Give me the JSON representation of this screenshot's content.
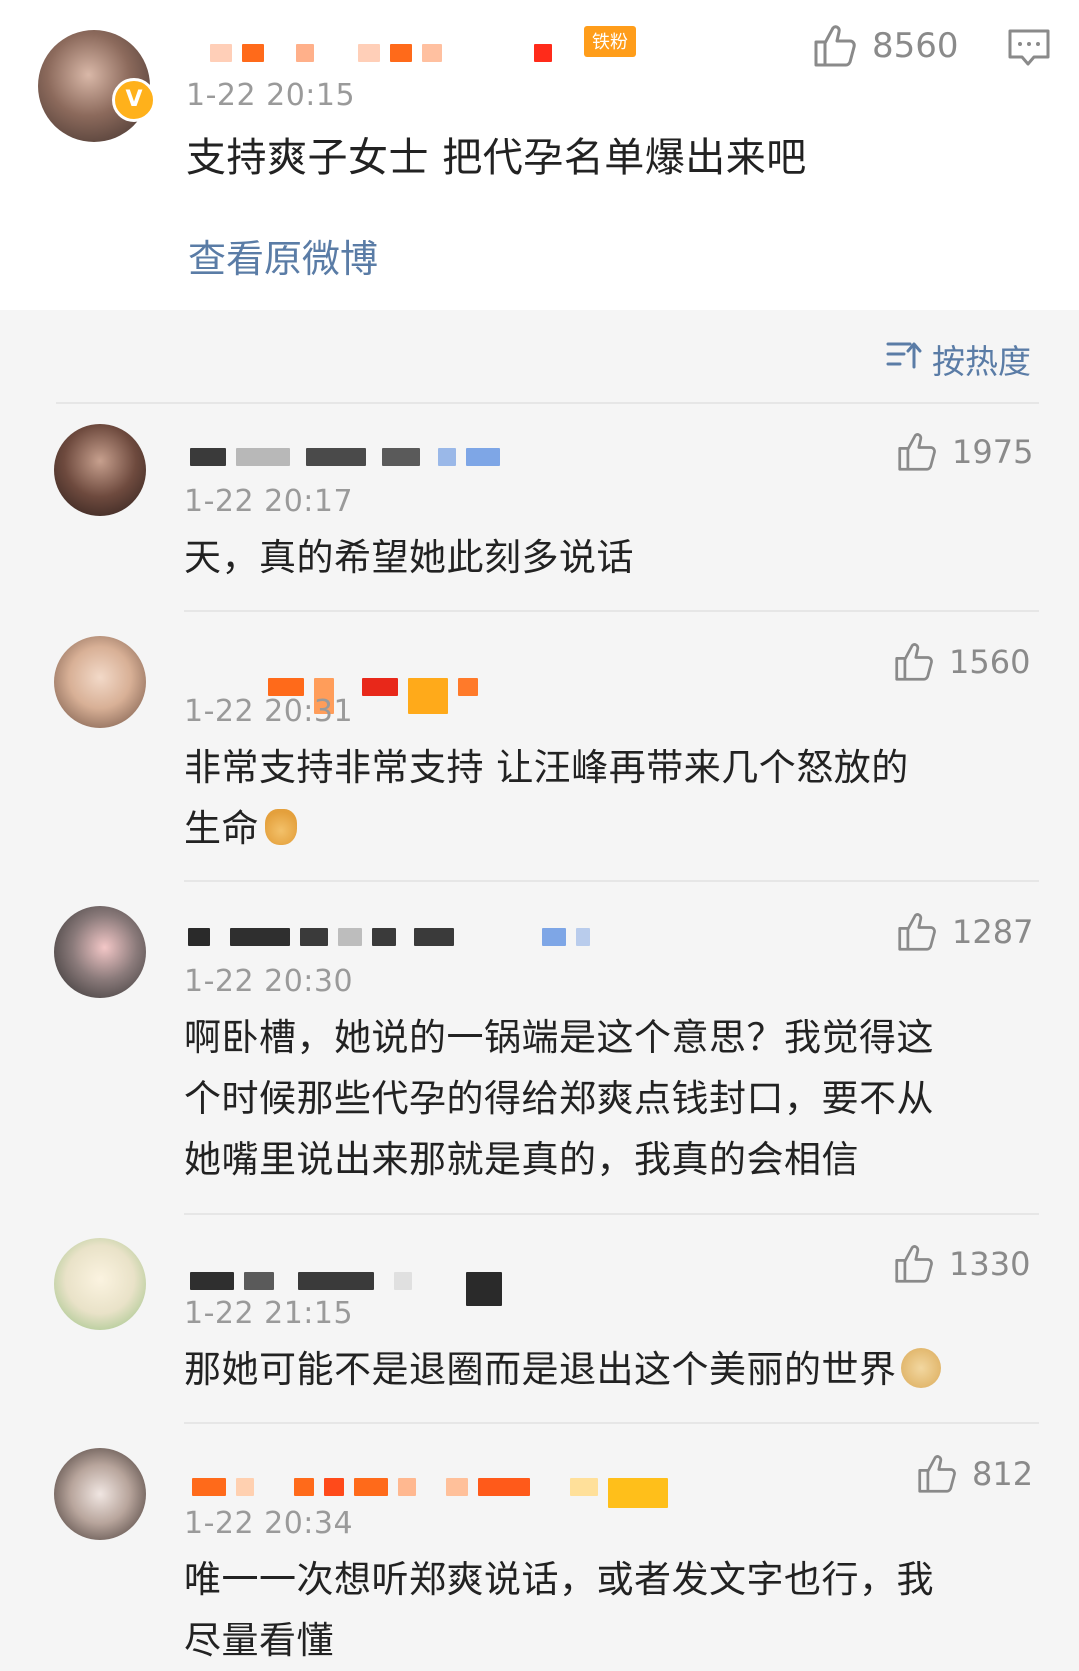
{
  "original_post": {
    "time": "1-22 20:15",
    "text": "支持爽子女士 把代孕名单爆出来吧",
    "view_original_label": "查看原微博",
    "likes": "8560",
    "fan_badge": "铁粉",
    "verified_badge": "V"
  },
  "sort": {
    "label": "按热度"
  },
  "comments": [
    {
      "time": "1-22 20:17",
      "text": "天，真的希望她此刻多说话",
      "likes": "1975"
    },
    {
      "time": "1-22 20:31",
      "text": "非常支持非常支持  让汪峰再带来几个怒放的\n生命",
      "likes": "1560"
    },
    {
      "time": "1-22 20:30",
      "text": "啊卧槽，她说的一锅端是这个意思？我觉得这\n个时候那些代孕的得给郑爽点钱封口，要不从\n她嘴里说出来那就是真的，我真的会相信",
      "likes": "1287"
    },
    {
      "time": "1-22 21:15",
      "text": "那她可能不是退圈而是退出这个美丽的世界",
      "likes": "1330"
    },
    {
      "time": "1-22 20:34",
      "text": "唯一一次想听郑爽说话，或者发文字也行，我\n尽量看懂",
      "likes": "812"
    }
  ],
  "icons": {
    "like": "thumbs-up-icon",
    "comment": "comment-icon",
    "sort": "sort-icon"
  },
  "colors": {
    "link": "#5a7ca6",
    "badge_orange": "#ff9d1a",
    "blur_orange": "#ff6a1a"
  }
}
